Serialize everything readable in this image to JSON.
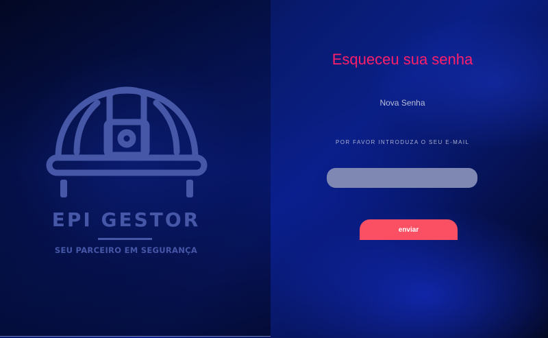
{
  "brand": {
    "logo_icon": "hard-hat-icon",
    "name": "EPI GESTOR",
    "slogan": "SEU PARCEIRO EM SEGURANÇA"
  },
  "form": {
    "title": "Esqueceu sua senha",
    "subtitle": "Nova Senha",
    "email_label": "POR FAVOR INTRODUZA O SEU E-MAIL",
    "email_value": "",
    "email_placeholder": "",
    "submit_label": "enviar"
  },
  "colors": {
    "title_accent": "#ff1f6a",
    "button": "#fb4f64",
    "input_fill": "#7f87b3",
    "logo": "#4657a8",
    "background_deep_blue": "#081a6e"
  }
}
